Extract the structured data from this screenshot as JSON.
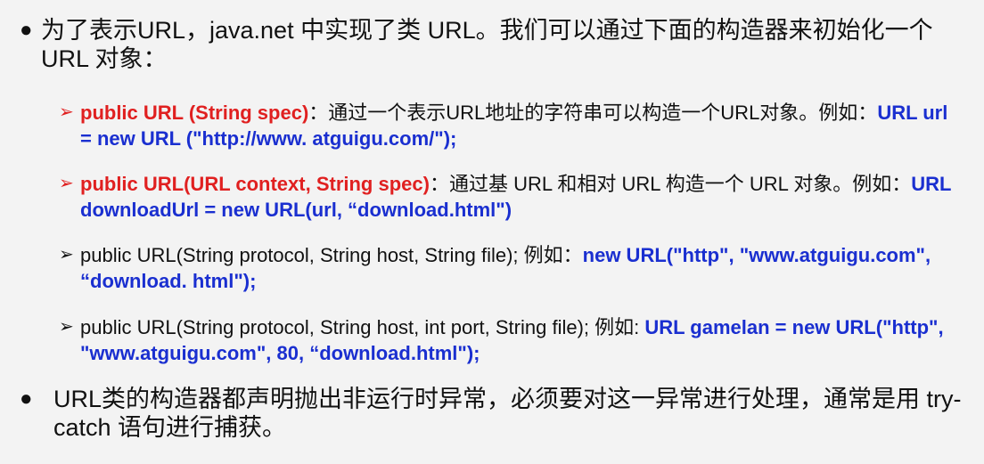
{
  "bullets": {
    "intro": {
      "marker": "●",
      "text": "为了表示URL，java.net 中实现了类 URL。我们可以通过下面的构造器来初始化一个 URL 对象："
    },
    "closing": {
      "marker": "●",
      "text": "URL类的构造器都声明抛出非运行时异常，必须要对这一异常进行处理，通常是用 try-catch 语句进行捕获。"
    }
  },
  "constructors": [
    {
      "marker": "➢",
      "signature": "public URL (String spec)",
      "description": "：通过一个表示URL地址的字符串可以构造一个URL对象。例如：",
      "example": "URL url = new URL (\"http://www. atguigu.com/\");"
    },
    {
      "marker": "➢",
      "signature": "public URL(URL context, String spec)",
      "description": "：通过基 URL 和相对 URL 构造一个 URL 对象。例如：",
      "example": "URL downloadUrl = new URL(url, “download.html\")"
    },
    {
      "marker": "➢",
      "signature": "public URL(String protocol, String host, String file); 例如：",
      "example": "new URL(\"http\", \"www.atguigu.com\", “download. html\");"
    },
    {
      "marker": "➢",
      "signature": "public URL(String protocol, String host, int port, String file); 例如: ",
      "example": "URL gamelan = new URL(\"http\", \"www.atguigu.com\", 80, “download.html\");"
    }
  ]
}
